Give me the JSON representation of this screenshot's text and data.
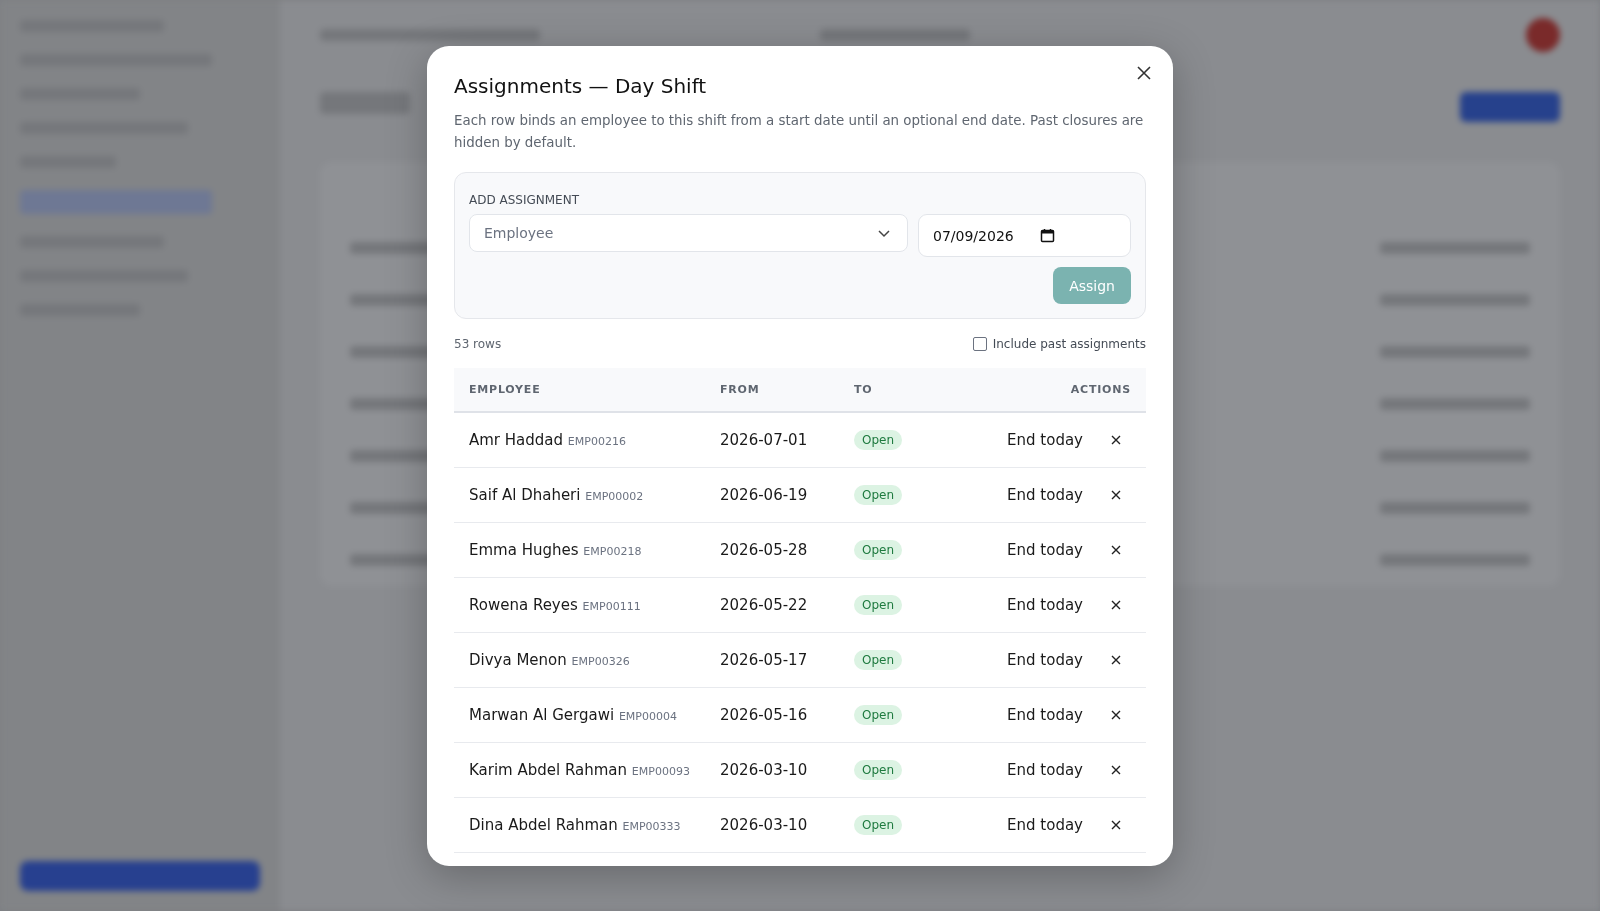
{
  "dialog": {
    "title": "Assignments — Day Shift",
    "description": "Each row binds an employee to this shift from a start date until an optional end date. Past closures are hidden by default.",
    "add_assignment": {
      "heading": "ADD ASSIGNMENT",
      "employee_placeholder": "Employee",
      "start_date": "07/09/2026",
      "assign_button": "Assign",
      "assign_disabled": true
    },
    "row_count": "53 rows",
    "include_past": {
      "label": "Include past assignments",
      "checked": false
    },
    "table": {
      "columns": [
        "EMPLOYEE",
        "FROM",
        "TO",
        "ACTIONS"
      ],
      "rows": [
        {
          "name": "Amr Haddad",
          "code": "EMP00216",
          "from": "2026-07-01",
          "to": "Open",
          "action": "End today"
        },
        {
          "name": "Saif Al Dhaheri",
          "code": "EMP00002",
          "from": "2026-06-19",
          "to": "Open",
          "action": "End today"
        },
        {
          "name": "Emma Hughes",
          "code": "EMP00218",
          "from": "2026-05-28",
          "to": "Open",
          "action": "End today"
        },
        {
          "name": "Rowena Reyes",
          "code": "EMP00111",
          "from": "2026-05-22",
          "to": "Open",
          "action": "End today"
        },
        {
          "name": "Divya Menon",
          "code": "EMP00326",
          "from": "2026-05-17",
          "to": "Open",
          "action": "End today"
        },
        {
          "name": "Marwan Al Gergawi",
          "code": "EMP00004",
          "from": "2026-05-16",
          "to": "Open",
          "action": "End today"
        },
        {
          "name": "Karim Abdel Rahman",
          "code": "EMP00093",
          "from": "2026-03-10",
          "to": "Open",
          "action": "End today"
        },
        {
          "name": "Dina Abdel Rahman",
          "code": "EMP00333",
          "from": "2026-03-10",
          "to": "Open",
          "action": "End today"
        }
      ]
    }
  }
}
